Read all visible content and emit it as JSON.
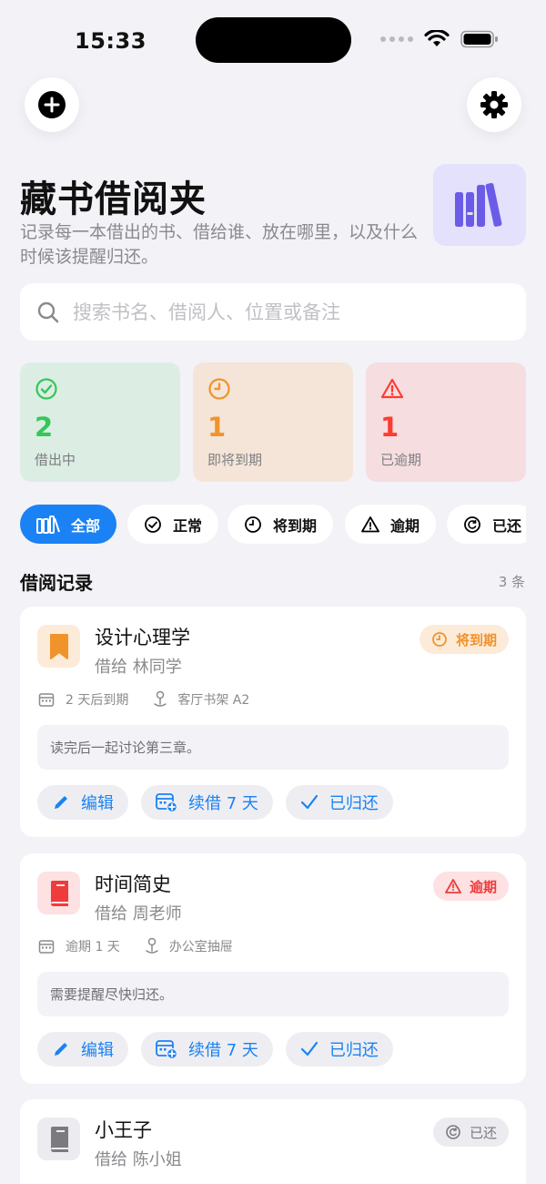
{
  "status_bar": {
    "time": "15:33"
  },
  "header": {
    "title": "藏书借阅夹",
    "subtitle": "记录每一本借出的书、借给谁、放在哪里，以及什么时候该提醒归还。"
  },
  "search": {
    "placeholder": "搜索书名、借阅人、位置或备注",
    "value": ""
  },
  "stats": [
    {
      "count": "2",
      "label": "借出中",
      "color": "#34c759",
      "bg": "#dceee4"
    },
    {
      "count": "1",
      "label": "即将到期",
      "color": "#f0932b",
      "bg": "#f4e5d8"
    },
    {
      "count": "1",
      "label": "已逾期",
      "color": "#ff3b30",
      "bg": "#f6dde0"
    }
  ],
  "filters": [
    {
      "label": "全部",
      "icon": "library-icon",
      "active": true
    },
    {
      "label": "正常",
      "icon": "check-circle-icon"
    },
    {
      "label": "将到期",
      "icon": "clock-icon"
    },
    {
      "label": "逾期",
      "icon": "warning-icon"
    },
    {
      "label": "已还",
      "icon": "return-icon"
    }
  ],
  "section": {
    "title": "借阅记录",
    "count": "3 条"
  },
  "records": [
    {
      "title": "设计心理学",
      "borrower": "借给 林同学",
      "status": "将到期",
      "due": "2 天后到期",
      "location": "客厅书架 A2",
      "note": "读完后一起讨论第三章。",
      "icon_color": "#f0932b",
      "icon_bg": "#fdebd9"
    },
    {
      "title": "时间简史",
      "borrower": "借给 周老师",
      "status": "逾期",
      "due": "逾期 1 天",
      "location": "办公室抽屉",
      "note": "需要提醒尽快归还。",
      "icon_color": "#ef3b3b",
      "icon_bg": "#fde1e3"
    },
    {
      "title": "小王子",
      "borrower": "借给 陈小姐",
      "status": "已还",
      "icon_color": "#7a7a7f",
      "icon_bg": "#ececf0"
    }
  ],
  "actions": {
    "edit": "编辑",
    "renew": "续借 7 天",
    "returned": "已归还"
  },
  "colors": {
    "accent": "#1a82f4",
    "background": "#f2f2f7"
  }
}
